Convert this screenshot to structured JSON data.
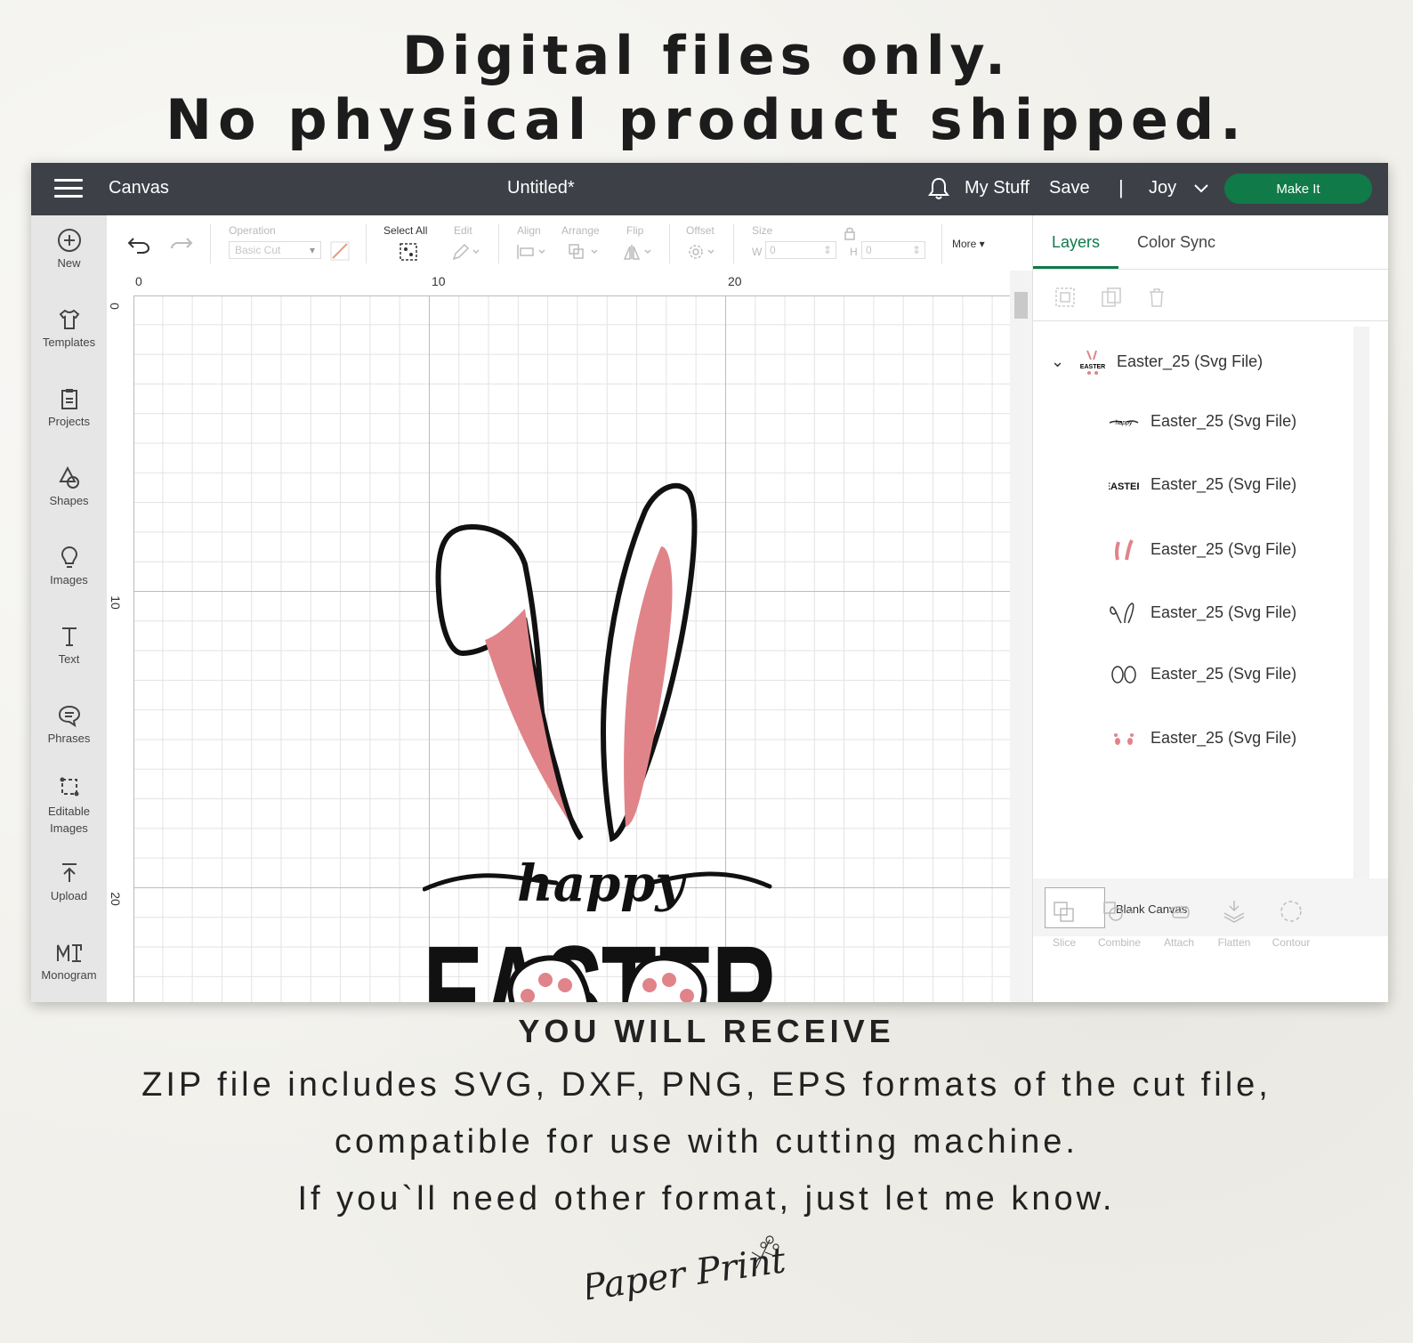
{
  "headline": {
    "line1": "Digital files only.",
    "line2": "No physical product shipped."
  },
  "topbar": {
    "menu_icon": "hamburger-icon",
    "app_title": "Canvas",
    "doc_title": "Untitled*",
    "bell_icon": "bell-icon",
    "my_stuff": "My Stuff",
    "save": "Save",
    "separator": "|",
    "user": "Joy",
    "make_it": "Make It",
    "accent": "#107a49"
  },
  "sidebar": {
    "items": [
      {
        "label": "New",
        "icon": "plus-circle-icon"
      },
      {
        "label": "Templates",
        "icon": "shirt-icon"
      },
      {
        "label": "Projects",
        "icon": "clipboard-icon"
      },
      {
        "label": "Shapes",
        "icon": "shapes-icon"
      },
      {
        "label": "Images",
        "icon": "lightbulb-icon"
      },
      {
        "label": "Text",
        "icon": "text-icon"
      },
      {
        "label": "Phrases",
        "icon": "speech-bubble-icon"
      },
      {
        "label": "Editable Images",
        "icon": "edit-image-icon"
      },
      {
        "label": "Upload",
        "icon": "upload-icon"
      },
      {
        "label": "Monogram",
        "icon": "monogram-icon"
      }
    ]
  },
  "toolbar": {
    "operation_label": "Operation",
    "operation_value": "Basic Cut",
    "select_all": "Select All",
    "edit": "Edit",
    "align": "Align",
    "arrange": "Arrange",
    "flip": "Flip",
    "offset": "Offset",
    "size": "Size",
    "w_label": "W",
    "w_value": "0",
    "h_label": "H",
    "h_value": "0",
    "more": "More"
  },
  "ruler": {
    "top_ticks": [
      "0",
      "10",
      "20"
    ],
    "left_ticks": [
      "0",
      "10",
      "20"
    ]
  },
  "artwork": {
    "script_text": "happy",
    "block_text": "EASTER",
    "pink": "#e0848a"
  },
  "panel": {
    "tabs": [
      "Layers",
      "Color Sync"
    ],
    "group_name": "Easter_25 (Svg File)",
    "layers": [
      "Easter_25 (Svg File)",
      "Easter_25 (Svg File)",
      "Easter_25 (Svg File)",
      "Easter_25 (Svg File)",
      "Easter_25 (Svg File)",
      "Easter_25 (Svg File)"
    ],
    "blank_canvas": "Blank Canvas",
    "bottom_tools": [
      "Slice",
      "Combine",
      "Attach",
      "Flatten",
      "Contour"
    ]
  },
  "footer": {
    "heading": "YOU WILL RECEIVE",
    "line1": "ZIP file includes SVG, DXF, PNG, EPS formats of the cut file,",
    "line2": "compatible for use with cutting machine.",
    "line3": "If you`ll need other format, just let me know.",
    "logo": "Paper Print"
  }
}
